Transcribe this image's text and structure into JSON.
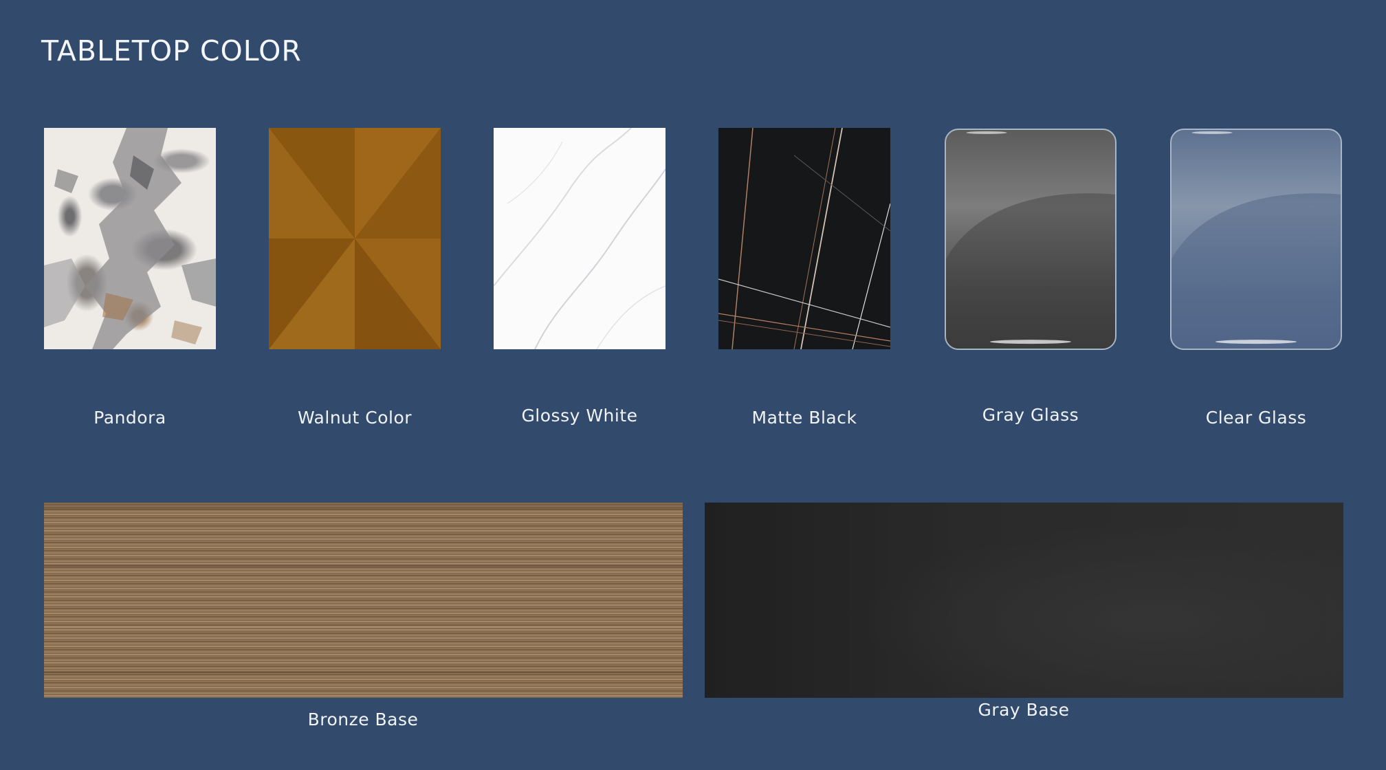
{
  "title": "TABLETOP COLOR",
  "tabletops": [
    {
      "label": "Pandora",
      "icon": "pandora-marble-texture"
    },
    {
      "label": "Walnut Color",
      "icon": "walnut-veneer-texture"
    },
    {
      "label": "Glossy White",
      "icon": "white-marble-texture"
    },
    {
      "label": "Matte Black",
      "icon": "black-marble-texture"
    },
    {
      "label": "Gray Glass",
      "icon": "gray-glass-texture"
    },
    {
      "label": "Clear Glass",
      "icon": "clear-glass-texture"
    }
  ],
  "bases": [
    {
      "label": "Bronze Base",
      "icon": "brushed-bronze-texture"
    },
    {
      "label": "Gray Base",
      "icon": "textured-gray-texture"
    }
  ],
  "colors": {
    "background": "#324a6b",
    "text": "#ffffff"
  }
}
